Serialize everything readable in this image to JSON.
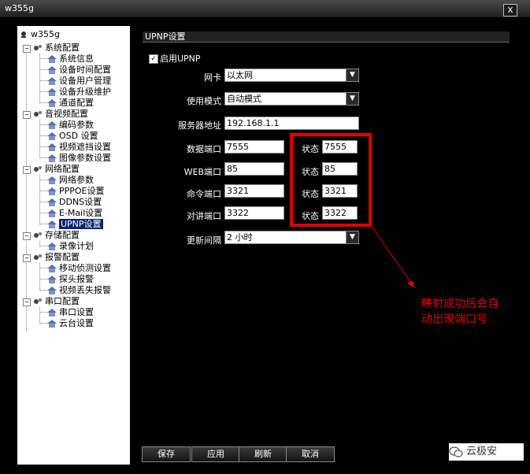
{
  "window": {
    "title": "w355g",
    "close": "x"
  },
  "tree": {
    "root": "w355g",
    "groups": [
      {
        "label": "系统配置",
        "items": [
          "系统信息",
          "设备时间配置",
          "设备用户管理",
          "设备升级维护",
          "通道配置"
        ]
      },
      {
        "label": "音视频配置",
        "items": [
          "编码参数",
          "OSD 设置",
          "视频遮挡设置",
          "图像参数设置"
        ]
      },
      {
        "label": "网络配置",
        "items": [
          "网络参数",
          "PPPOE设置",
          "DDNS设置",
          "E-Mail设置",
          "UPNP设置"
        ]
      },
      {
        "label": "存储配置",
        "items": [
          "录像计划"
        ]
      },
      {
        "label": "报警配置",
        "items": [
          "移动侦测设置",
          "探头报警",
          "视频丢失报警"
        ]
      },
      {
        "label": "串口配置",
        "items": [
          "串口设置",
          "云台设置"
        ]
      }
    ],
    "selected": "UPNP设置"
  },
  "panel": {
    "header": "UPNP设置",
    "enable_label": "启用UPNP",
    "enable_checked": true,
    "nic_label": "网卡",
    "nic_value": "以太网",
    "mode_label": "使用模式",
    "mode_value": "自动模式",
    "server_label": "服务器地址",
    "server_value": "192.168.1.1",
    "ports": [
      {
        "label": "数据端口",
        "value": "7555",
        "status_label": "状态",
        "status_value": "7555"
      },
      {
        "label": "WEB端口",
        "value": "85",
        "status_label": "状态",
        "status_value": "85"
      },
      {
        "label": "命令端口",
        "value": "3321",
        "status_label": "状态",
        "status_value": "3321"
      },
      {
        "label": "对讲端口",
        "value": "3322",
        "status_label": "状态",
        "status_value": "3322"
      }
    ],
    "interval_label": "更新间隔",
    "interval_value": "2 小时"
  },
  "annotation": {
    "line1": "映射成功后会自",
    "line2": "动出现端口号"
  },
  "buttons": {
    "save": "保存",
    "apply": "应用",
    "refresh": "刷新",
    "cancel": "取消"
  },
  "watermark": "云极安",
  "colors": {
    "background": "#000000",
    "highlight": "#e00000",
    "selection": "#0a246a"
  }
}
